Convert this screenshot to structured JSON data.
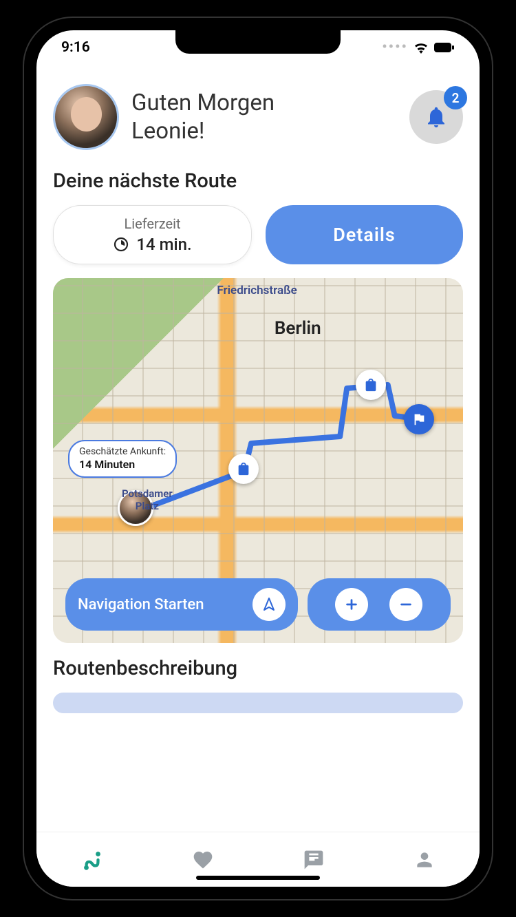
{
  "status": {
    "time": "9:16"
  },
  "header": {
    "greeting_line1": "Guten Morgen",
    "greeting_line2": "Leonie!",
    "notification_count": "2"
  },
  "next_route": {
    "title": "Deine nächste Route",
    "delivery_label": "Lieferzeit",
    "delivery_value": "14 min.",
    "details_button": "Details"
  },
  "map": {
    "city": "Berlin",
    "street_top": "Friedrichstraße",
    "square": "Potsdamer\nPlatz",
    "eta_label": "Geschätzte Ankunft:",
    "eta_value": "14 Minuten",
    "nav_button": "Navigation Starten"
  },
  "description": {
    "title": "Routenbeschreibung"
  },
  "colors": {
    "primary": "#5a8fe8",
    "accent_dark": "#2d66d8",
    "tab_active": "#1a9e87"
  }
}
